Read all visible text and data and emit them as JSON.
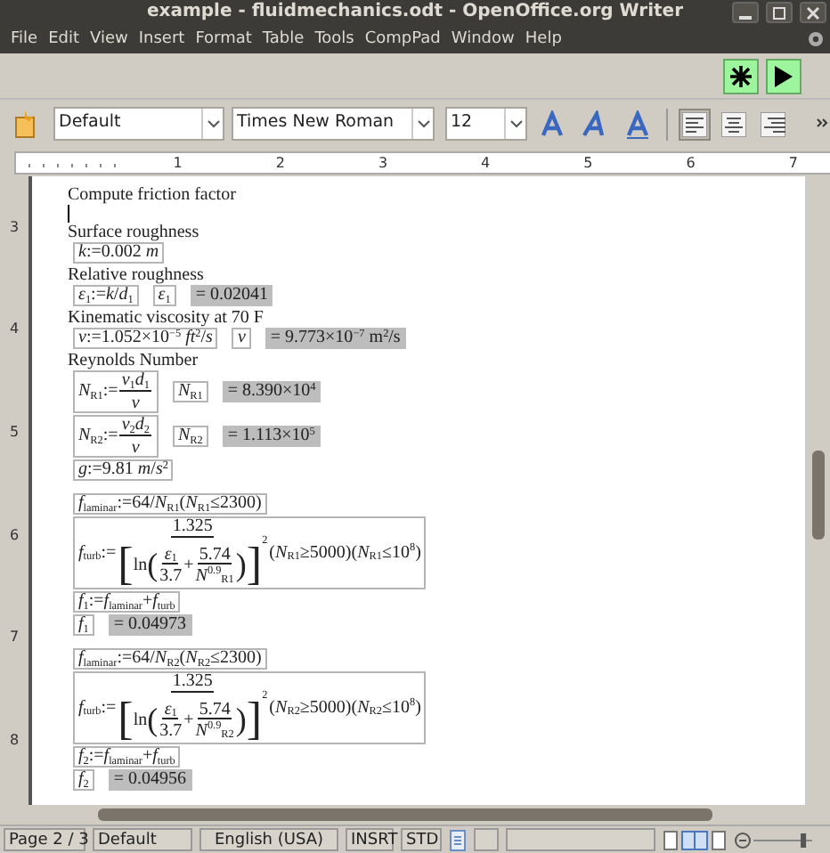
{
  "window": {
    "title": "example - fluidmechanics.odt - OpenOffice.org Writer"
  },
  "menu": [
    "File",
    "Edit",
    "View",
    "Insert",
    "Format",
    "Table",
    "Tools",
    "CompPad",
    "Window",
    "Help"
  ],
  "formatting": {
    "paragraph_style": "Default",
    "font_name": "Times New Roman",
    "font_size": "12",
    "alignment": [
      {
        "selected": true
      },
      {
        "selected": false
      },
      {
        "selected": false
      }
    ]
  },
  "ruler": {
    "horizontal": [
      "1",
      "2",
      "3",
      "4",
      "5",
      "6",
      "7"
    ],
    "vertical": [
      "3",
      "4",
      "5",
      "6",
      "7",
      "8"
    ]
  },
  "document": [
    {
      "kind": "text",
      "text": "Compute friction factor"
    },
    {
      "kind": "cursor"
    },
    {
      "kind": "text",
      "text": "Surface roughness"
    },
    {
      "kind": "math",
      "items": [
        {
          "kind": "box",
          "seq": [
            "*k*:=0.002 *m*"
          ]
        }
      ]
    },
    {
      "kind": "text",
      "text": "Relative roughness"
    },
    {
      "kind": "math",
      "items": [
        {
          "kind": "box",
          "seq": [
            "*ε*$_{1}$:=*k*/*d*$_{1}$"
          ]
        },
        {
          "kind": "box",
          "seq": [
            "*ε*$_{1}$"
          ]
        },
        {
          "kind": "result",
          "text": "= 0.02041"
        }
      ]
    },
    {
      "kind": "text",
      "text": "Kinematic viscosity at 70 F"
    },
    {
      "kind": "math",
      "items": [
        {
          "kind": "box",
          "seq": [
            "*v*:=1.052×10$^{−5}$ *ft*$^{2}$/*s*"
          ]
        },
        {
          "kind": "box",
          "seq": [
            "*v*"
          ]
        },
        {
          "kind": "result",
          "text": "= 9.773×10$^{−7}$ m$^{2}$/s"
        }
      ]
    },
    {
      "kind": "text",
      "text": "Reynolds Number"
    },
    {
      "kind": "math",
      "items": [
        {
          "kind": "box",
          "seq": [
            "*N*$_{R1}$:=",
            {
              "num": [
                "*v*$_{1}$*d*$_{1}$"
              ],
              "den": [
                "*v*"
              ]
            }
          ]
        },
        {
          "kind": "box",
          "seq": [
            "*N*$_{R1}$"
          ]
        },
        {
          "kind": "result",
          "text": "= 8.390×10$^{4}$"
        }
      ]
    },
    {
      "kind": "math",
      "items": [
        {
          "kind": "box",
          "seq": [
            "*N*$_{R2}$:=",
            {
              "num": [
                "*v*$_{2}$*d*$_{2}$"
              ],
              "den": [
                "*v*"
              ]
            }
          ]
        },
        {
          "kind": "box",
          "seq": [
            "*N*$_{R2}$"
          ]
        },
        {
          "kind": "result",
          "text": "= 1.113×10$^{5}$"
        }
      ]
    },
    {
      "kind": "math",
      "items": [
        {
          "kind": "box",
          "seq": [
            "*g*:=9.81 *m*/*s*$^{2}$"
          ]
        }
      ]
    },
    {
      "kind": "spacer"
    },
    {
      "kind": "math",
      "items": [
        {
          "kind": "box",
          "seq": [
            "*f*$_{laminar}$:=64/*N*$_{R1}$(*N*$_{R1}$≤2300)"
          ]
        }
      ]
    },
    {
      "kind": "math",
      "items": [
        {
          "kind": "box",
          "seq": [
            "*f*$_{turb}$:=",
            {
              "num": [
                "1.325"
              ],
              "den": [
                {
                  "open": "[",
                  "close": "]",
                  "sup": "2",
                  "body": [
                    "ln",
                    {
                      "open": "(",
                      "close": ")",
                      "body": [
                        {
                          "num": [
                            "*ε*$_{1}$"
                          ],
                          "den": [
                            "3.7"
                          ]
                        },
                        "+",
                        {
                          "num": [
                            "5.74"
                          ],
                          "den": [
                            "*N*$^{0.9}$$_{R1}$"
                          ]
                        }
                      ]
                    }
                  ]
                }
              ]
            },
            "(*N*$_{R1}$≥5000)(*N*$_{R1}$≤10$^{8}$)"
          ]
        }
      ]
    },
    {
      "kind": "math",
      "items": [
        {
          "kind": "box",
          "seq": [
            "*f*$_{1}$:=*f*$_{laminar}$+*f*$_{turb}$"
          ]
        }
      ]
    },
    {
      "kind": "math",
      "items": [
        {
          "kind": "box",
          "seq": [
            "*f*$_{1}$"
          ]
        },
        {
          "kind": "result",
          "text": "= 0.04973"
        }
      ]
    },
    {
      "kind": "spacer"
    },
    {
      "kind": "math",
      "items": [
        {
          "kind": "box",
          "seq": [
            "*f*$_{laminar}$:=64/*N*$_{R2}$(*N*$_{R2}$≤2300)"
          ]
        }
      ]
    },
    {
      "kind": "math",
      "items": [
        {
          "kind": "box",
          "seq": [
            "*f*$_{turb}$:=",
            {
              "num": [
                "1.325"
              ],
              "den": [
                {
                  "open": "[",
                  "close": "]",
                  "sup": "2",
                  "body": [
                    "ln",
                    {
                      "open": "(",
                      "close": ")",
                      "body": [
                        {
                          "num": [
                            "*ε*$_{1}$"
                          ],
                          "den": [
                            "3.7"
                          ]
                        },
                        "+",
                        {
                          "num": [
                            "5.74"
                          ],
                          "den": [
                            "*N*$^{0.9}$$_{R2}$"
                          ]
                        }
                      ]
                    }
                  ]
                }
              ]
            },
            "(*N*$_{R2}$≥5000)(*N*$_{R2}$≤10$^{8}$)"
          ]
        }
      ]
    },
    {
      "kind": "math",
      "items": [
        {
          "kind": "box",
          "seq": [
            "*f*$_{2}$:=*f*$_{laminar}$+*f*$_{turb}$"
          ]
        }
      ]
    },
    {
      "kind": "math",
      "items": [
        {
          "kind": "box",
          "seq": [
            "*f*$_{2}$"
          ]
        },
        {
          "kind": "result",
          "text": "= 0.04956"
        }
      ]
    }
  ],
  "zoom_slider": {
    "level": 0.85
  },
  "status_bar": {
    "page": "Page 2 / 3",
    "page_style": "Default",
    "language": "English (USA)",
    "insert_mode": "INSRT",
    "selection_mode": "STD"
  }
}
